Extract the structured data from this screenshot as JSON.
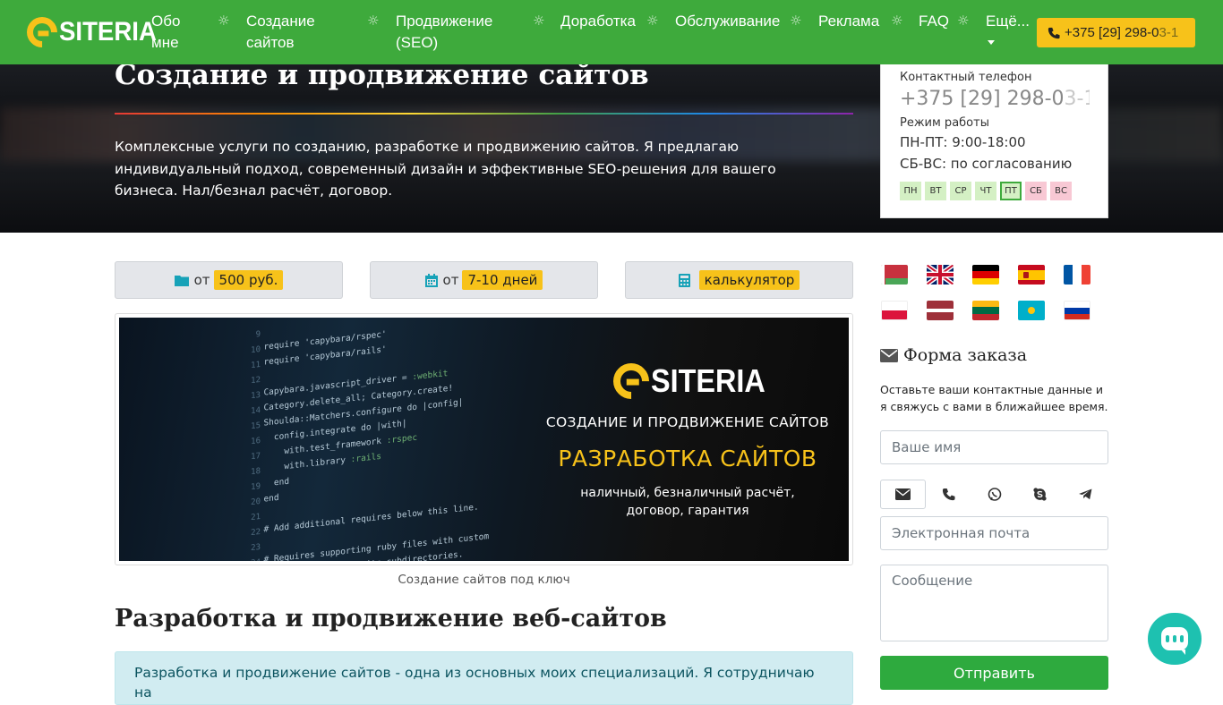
{
  "nav": {
    "logo_text": "SITERIA",
    "items": [
      {
        "label": "Обо",
        "label2": "мне"
      },
      {
        "label": "Создание",
        "label2": "сайтов"
      },
      {
        "label": "Продвижение",
        "label2": "(SEO)"
      },
      {
        "label": "Доработка"
      },
      {
        "label": "Обслуживание"
      },
      {
        "label": "Реклама"
      },
      {
        "label": "FAQ"
      },
      {
        "label": "Ещё..."
      }
    ],
    "separator": "☼",
    "phone_visible": "+375 [29] 298-0",
    "phone_faded": "3-1"
  },
  "hero": {
    "title": "Создание и продвижение сайтов",
    "text": "Комплексные услуги по созданию, разработке и продвижению сайтов. Я предлагаю индивидуальный подход, современный дизайн и эффективные SEO-решения для вашего бизнеса. Нал/безнал расчёт, договор."
  },
  "contact": {
    "phone_label": "Контактный телефон",
    "phone_visible": "+375 [29] 298-0",
    "phone_faded": "3-1",
    "hours_label": "Режим работы",
    "weekdays": "ПН-ПТ: 9:00-18:00",
    "weekend": "СБ-ВС: по согласованию",
    "days": [
      {
        "label": "ПН",
        "state": "work"
      },
      {
        "label": "ВТ",
        "state": "work"
      },
      {
        "label": "СР",
        "state": "work"
      },
      {
        "label": "ЧТ",
        "state": "work"
      },
      {
        "label": "ПТ",
        "state": "today"
      },
      {
        "label": "СБ",
        "state": "off"
      },
      {
        "label": "ВС",
        "state": "off"
      }
    ]
  },
  "info": [
    {
      "icon": "folder-icon",
      "prefix": "от",
      "badge": "500 руб."
    },
    {
      "icon": "calendar-icon",
      "prefix": "от",
      "badge": "7-10 дней"
    },
    {
      "icon": "calculator-icon",
      "prefix": "",
      "badge": "калькулятор"
    }
  ],
  "banner": {
    "logo_text": "SITERIA",
    "line1": "СОЗДАНИЕ И ПРОДВИЖЕНИЕ САЙТОВ",
    "line2": "РАЗРАБОТКА САЙТОВ",
    "line3a": "наличный, безналичный расчёт,",
    "line3b": "договор, гарантия",
    "caption": "Создание сайтов под ключ"
  },
  "main": {
    "section_title": "Разработка и продвижение веб-сайтов",
    "alert_text": "Разработка и продвижение сайтов - одна из основных моих специализаций. Я сотрудничаю на"
  },
  "flags": [
    "by",
    "gb",
    "de",
    "es",
    "fr",
    "pl",
    "lv",
    "lt",
    "kz",
    "ru"
  ],
  "form": {
    "title": "Форма заказа",
    "description": "Оставьте ваши контактные данные и я свяжусь с вами в ближайшее время.",
    "name_placeholder": "Ваше имя",
    "email_placeholder": "Электронная почта",
    "message_placeholder": "Сообщение",
    "submit_label": "Отправить",
    "contact_tabs": [
      "envelope-icon",
      "phone-icon",
      "viber-icon",
      "skype-icon",
      "telegram-icon"
    ]
  },
  "colors": {
    "nav_green": "#3eaa3c",
    "accent_yellow": "#f7c21a",
    "submit_green": "#2eaa3e",
    "chat_teal": "#1ec1b0"
  }
}
